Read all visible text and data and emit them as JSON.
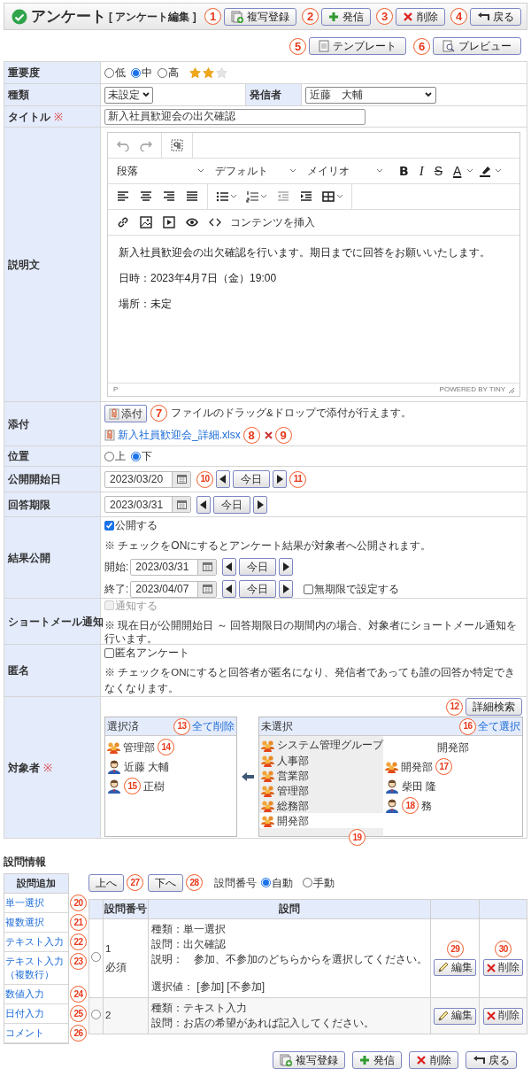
{
  "header": {
    "title": "アンケート",
    "subtitle": "[ アンケート編集 ]",
    "buttons": [
      {
        "label": "複写登録",
        "kind": "copy"
      },
      {
        "label": "発信",
        "kind": "send"
      },
      {
        "label": "削除",
        "kind": "delete"
      },
      {
        "label": "戻る",
        "kind": "back"
      }
    ]
  },
  "sub_buttons": [
    {
      "label": "テンプレート",
      "kind": "template"
    },
    {
      "label": "プレビュー",
      "kind": "preview"
    }
  ],
  "form": {
    "importance": {
      "label": "重要度",
      "options": [
        {
          "label": "低",
          "selected": false
        },
        {
          "label": "中",
          "selected": true
        },
        {
          "label": "高",
          "selected": false
        }
      ],
      "stars": 2
    },
    "type": {
      "label": "種類",
      "value": "未設定"
    },
    "sender": {
      "label": "発信者",
      "value": "近藤　大輔"
    },
    "title": {
      "label": "タイトル",
      "required_mark": "※",
      "value": "新入社員歓迎会の出欠確認"
    },
    "description": {
      "label": "説明文",
      "toolbar": {
        "block": "段落",
        "font_size": "デフォルト",
        "font_family": "メイリオ",
        "format_buttons": [
          {
            "label": "B",
            "kind": "bold"
          },
          {
            "label": "I",
            "kind": "italic"
          },
          {
            "label": "S",
            "kind": "strike"
          },
          {
            "label": "A",
            "kind": "color"
          }
        ],
        "insert_label": "コンテンツを挿入"
      },
      "paragraphs": [
        "新入社員歓迎会の出欠確認を行います。期日までに回答をお願いいたします。",
        "日時：2023年4月7日（金）19:00",
        "場所：未定"
      ],
      "status_path": "P",
      "branding": "POWERED BY TINY"
    },
    "attachment": {
      "label": "添付",
      "button": "添付",
      "hint": "ファイルのドラッグ&ドロップで添付が行えます。",
      "files": [
        {
          "name": "新入社員歓迎会_詳細.xlsx"
        }
      ]
    },
    "position": {
      "label": "位置",
      "options": [
        {
          "label": "上",
          "selected": false
        },
        {
          "label": "下",
          "selected": true
        }
      ]
    },
    "publish_start": {
      "label": "公開開始日",
      "value": "2023/03/20",
      "today": "今日"
    },
    "deadline": {
      "label": "回答期限",
      "value": "2023/03/31",
      "today": "今日"
    },
    "result_publish": {
      "label": "結果公開",
      "checkbox": {
        "label": "公開する",
        "checked": true
      },
      "note": "※ チェックをONにするとアンケート結果が対象者へ公開されます。",
      "start": {
        "label": "開始:",
        "value": "2023/03/31",
        "today": "今日"
      },
      "end": {
        "label": "終了:",
        "value": "2023/04/07",
        "today": "今日"
      },
      "no_limit": {
        "label": "無期限で設定する",
        "checked": false
      }
    },
    "short_mail": {
      "label": "ショートメール通知",
      "checkbox": {
        "label": "通知する",
        "checked": false,
        "disabled": true
      },
      "note": "※ 現在日が公開開始日 ～ 回答期限日の期間内の場合、対象者にショートメール通知を行います。"
    },
    "anonymous": {
      "label": "匿名",
      "checkbox": {
        "label": "匿名アンケート",
        "checked": false
      },
      "note": "※ チェックをONにすると回答者が匿名になり、発信者であっても誰の回答か特定できなくなります。"
    },
    "targets": {
      "label": "対象者",
      "required_mark": "※",
      "search_button": "詳細検索",
      "selected_panel": {
        "title": "選択済",
        "action": "全て削除",
        "items": [
          {
            "kind": "group",
            "name": "管理部"
          },
          {
            "kind": "user",
            "name": "近藤 大輔"
          },
          {
            "kind": "user",
            "name": "正樹"
          }
        ]
      },
      "unselected_panel": {
        "title": "未選択",
        "action": "全て選択",
        "groups": [
          {
            "name": "システム管理グループ",
            "selected": false
          },
          {
            "name": "人事部",
            "selected": false
          },
          {
            "name": "営業部",
            "selected": false
          },
          {
            "name": "管理部",
            "selected": false
          },
          {
            "name": "総務部",
            "selected": false
          },
          {
            "name": "開発部",
            "selected": true
          }
        ],
        "members_title": "開発部",
        "members": [
          {
            "kind": "group",
            "name": "開発部"
          },
          {
            "kind": "user",
            "name": "柴田 隆"
          },
          {
            "kind": "user",
            "name": "務"
          }
        ]
      }
    }
  },
  "questions": {
    "title": "設問情報",
    "add_panel": {
      "title": "設問追加",
      "items": [
        "単一選択",
        "複数選択",
        "テキスト入力",
        "テキスト入力（複数行）",
        "数値入力",
        "日付入力",
        "コメント"
      ]
    },
    "move_buttons": [
      "上へ",
      "下へ"
    ],
    "numbering": {
      "label": "設問番号",
      "options": [
        {
          "label": "自動",
          "selected": true
        },
        {
          "label": "手動",
          "selected": false
        }
      ]
    },
    "columns": {
      "number": "設問番号",
      "question": "設問"
    },
    "rows": [
      {
        "selected": false,
        "number": "1",
        "required": "必須",
        "lines": [
          "種類：単一選択",
          "設問：出欠確認",
          "説明：　参加、不参加のどちらからを選択してください。"
        ],
        "choices": "選択値： [参加] [不参加]",
        "edit": "編集",
        "delete": "削除"
      },
      {
        "selected": false,
        "number": "2",
        "lines": [
          "種類：テキスト入力",
          "設問：お店の希望があれば記入してください。"
        ],
        "edit": "編集",
        "delete": "削除"
      }
    ]
  },
  "footer_buttons": [
    {
      "label": "複写登録",
      "kind": "copy"
    },
    {
      "label": "発信",
      "kind": "send"
    },
    {
      "label": "削除",
      "kind": "delete"
    },
    {
      "label": "戻る",
      "kind": "back"
    }
  ],
  "callouts": [
    "1",
    "2",
    "3",
    "4",
    "5",
    "6",
    "7",
    "8",
    "9",
    "10",
    "11",
    "12",
    "13",
    "14",
    "15",
    "16",
    "17",
    "18",
    "19",
    "20",
    "21",
    "22",
    "23",
    "24",
    "25",
    "26",
    "27",
    "28",
    "29",
    "30"
  ]
}
